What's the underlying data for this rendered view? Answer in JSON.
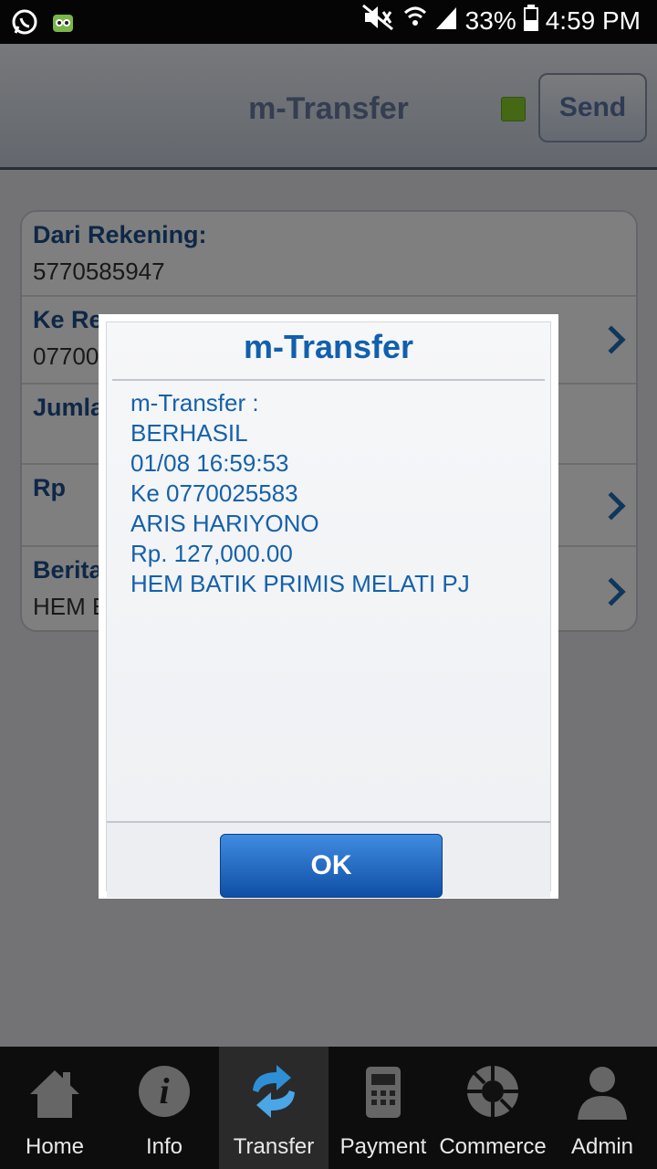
{
  "status_bar": {
    "battery": "33%",
    "time": "4:59 PM",
    "left_icons": [
      "whatsapp-icon",
      "tokopedia-icon"
    ],
    "right_icons": [
      "mute-icon",
      "wifi-icon",
      "signal-icon",
      "battery-icon"
    ]
  },
  "header": {
    "title": "m-Transfer",
    "send_label": "Send",
    "status_led_color": "#8bd12b"
  },
  "form": {
    "from_label": "Dari Rekening:",
    "from_value": "5770585947",
    "to_label": "Ke Re",
    "to_value": "07700",
    "amount_label": "Jumla",
    "rp_label": "Rp",
    "note_label": "Berita",
    "note_value": "HEM E"
  },
  "dialog": {
    "title": "m-Transfer",
    "lines": [
      "m-Transfer :",
      "BERHASIL",
      "01/08 16:59:53",
      "Ke 0770025583",
      "ARIS HARIYONO",
      "Rp. 127,000.00",
      "HEM BATIK PRIMIS MELATI PJ"
    ],
    "ok_label": "OK"
  },
  "nav": {
    "items": [
      {
        "label": "Home",
        "icon": "home-icon"
      },
      {
        "label": "Info",
        "icon": "info-icon"
      },
      {
        "label": "Transfer",
        "icon": "transfer-icon",
        "active": true
      },
      {
        "label": "Payment",
        "icon": "payment-icon"
      },
      {
        "label": "Commerce",
        "icon": "commerce-icon"
      },
      {
        "label": "Admin",
        "icon": "admin-icon"
      }
    ]
  },
  "colors": {
    "accent": "#1260ad",
    "ok_button": "#1f6cc4"
  }
}
